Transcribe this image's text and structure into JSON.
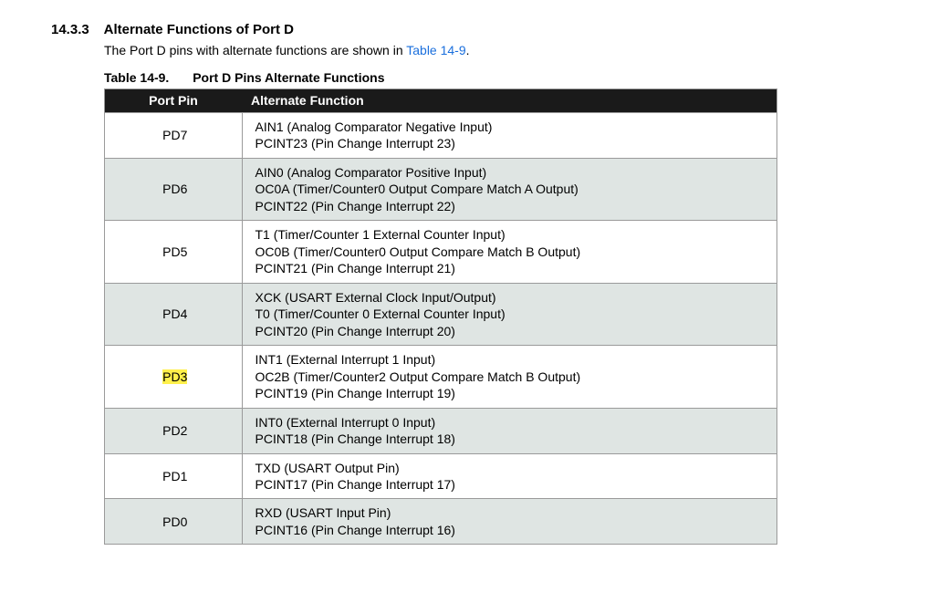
{
  "section": {
    "number": "14.3.3",
    "title": "Alternate Functions of Port D"
  },
  "intro": {
    "before": "The Port D pins with alternate functions are shown in ",
    "ref": "Table 14-9",
    "after": "."
  },
  "caption": {
    "label": "Table 14-9.",
    "text": "Port D Pins Alternate Functions"
  },
  "table": {
    "headers": {
      "pin": "Port Pin",
      "func": "Alternate Function"
    },
    "rows": [
      {
        "pin": "PD7",
        "highlight": false,
        "funcs": [
          "AIN1 (Analog Comparator Negative Input)",
          "PCINT23 (Pin Change Interrupt 23)"
        ]
      },
      {
        "pin": "PD6",
        "highlight": false,
        "funcs": [
          "AIN0 (Analog Comparator Positive Input)",
          "OC0A (Timer/Counter0 Output Compare Match A Output)",
          "PCINT22 (Pin Change Interrupt 22)"
        ]
      },
      {
        "pin": "PD5",
        "highlight": false,
        "funcs": [
          "T1 (Timer/Counter 1 External Counter Input)",
          "OC0B (Timer/Counter0 Output Compare Match B Output)",
          "PCINT21 (Pin Change Interrupt 21)"
        ]
      },
      {
        "pin": "PD4",
        "highlight": false,
        "funcs": [
          "XCK (USART External Clock Input/Output)",
          "T0 (Timer/Counter 0 External Counter Input)",
          "PCINT20 (Pin Change Interrupt 20)"
        ]
      },
      {
        "pin": "PD3",
        "highlight": true,
        "funcs": [
          "INT1 (External Interrupt 1 Input)",
          "OC2B (Timer/Counter2 Output Compare Match B Output)",
          "PCINT19 (Pin Change Interrupt 19)"
        ]
      },
      {
        "pin": "PD2",
        "highlight": false,
        "funcs": [
          "INT0 (External Interrupt 0 Input)",
          "PCINT18 (Pin Change Interrupt 18)"
        ]
      },
      {
        "pin": "PD1",
        "highlight": false,
        "funcs": [
          "TXD (USART Output Pin)",
          "PCINT17 (Pin Change Interrupt 17)"
        ]
      },
      {
        "pin": "PD0",
        "highlight": false,
        "funcs": [
          "RXD (USART Input Pin)",
          "PCINT16 (Pin Change Interrupt 16)"
        ]
      }
    ]
  }
}
